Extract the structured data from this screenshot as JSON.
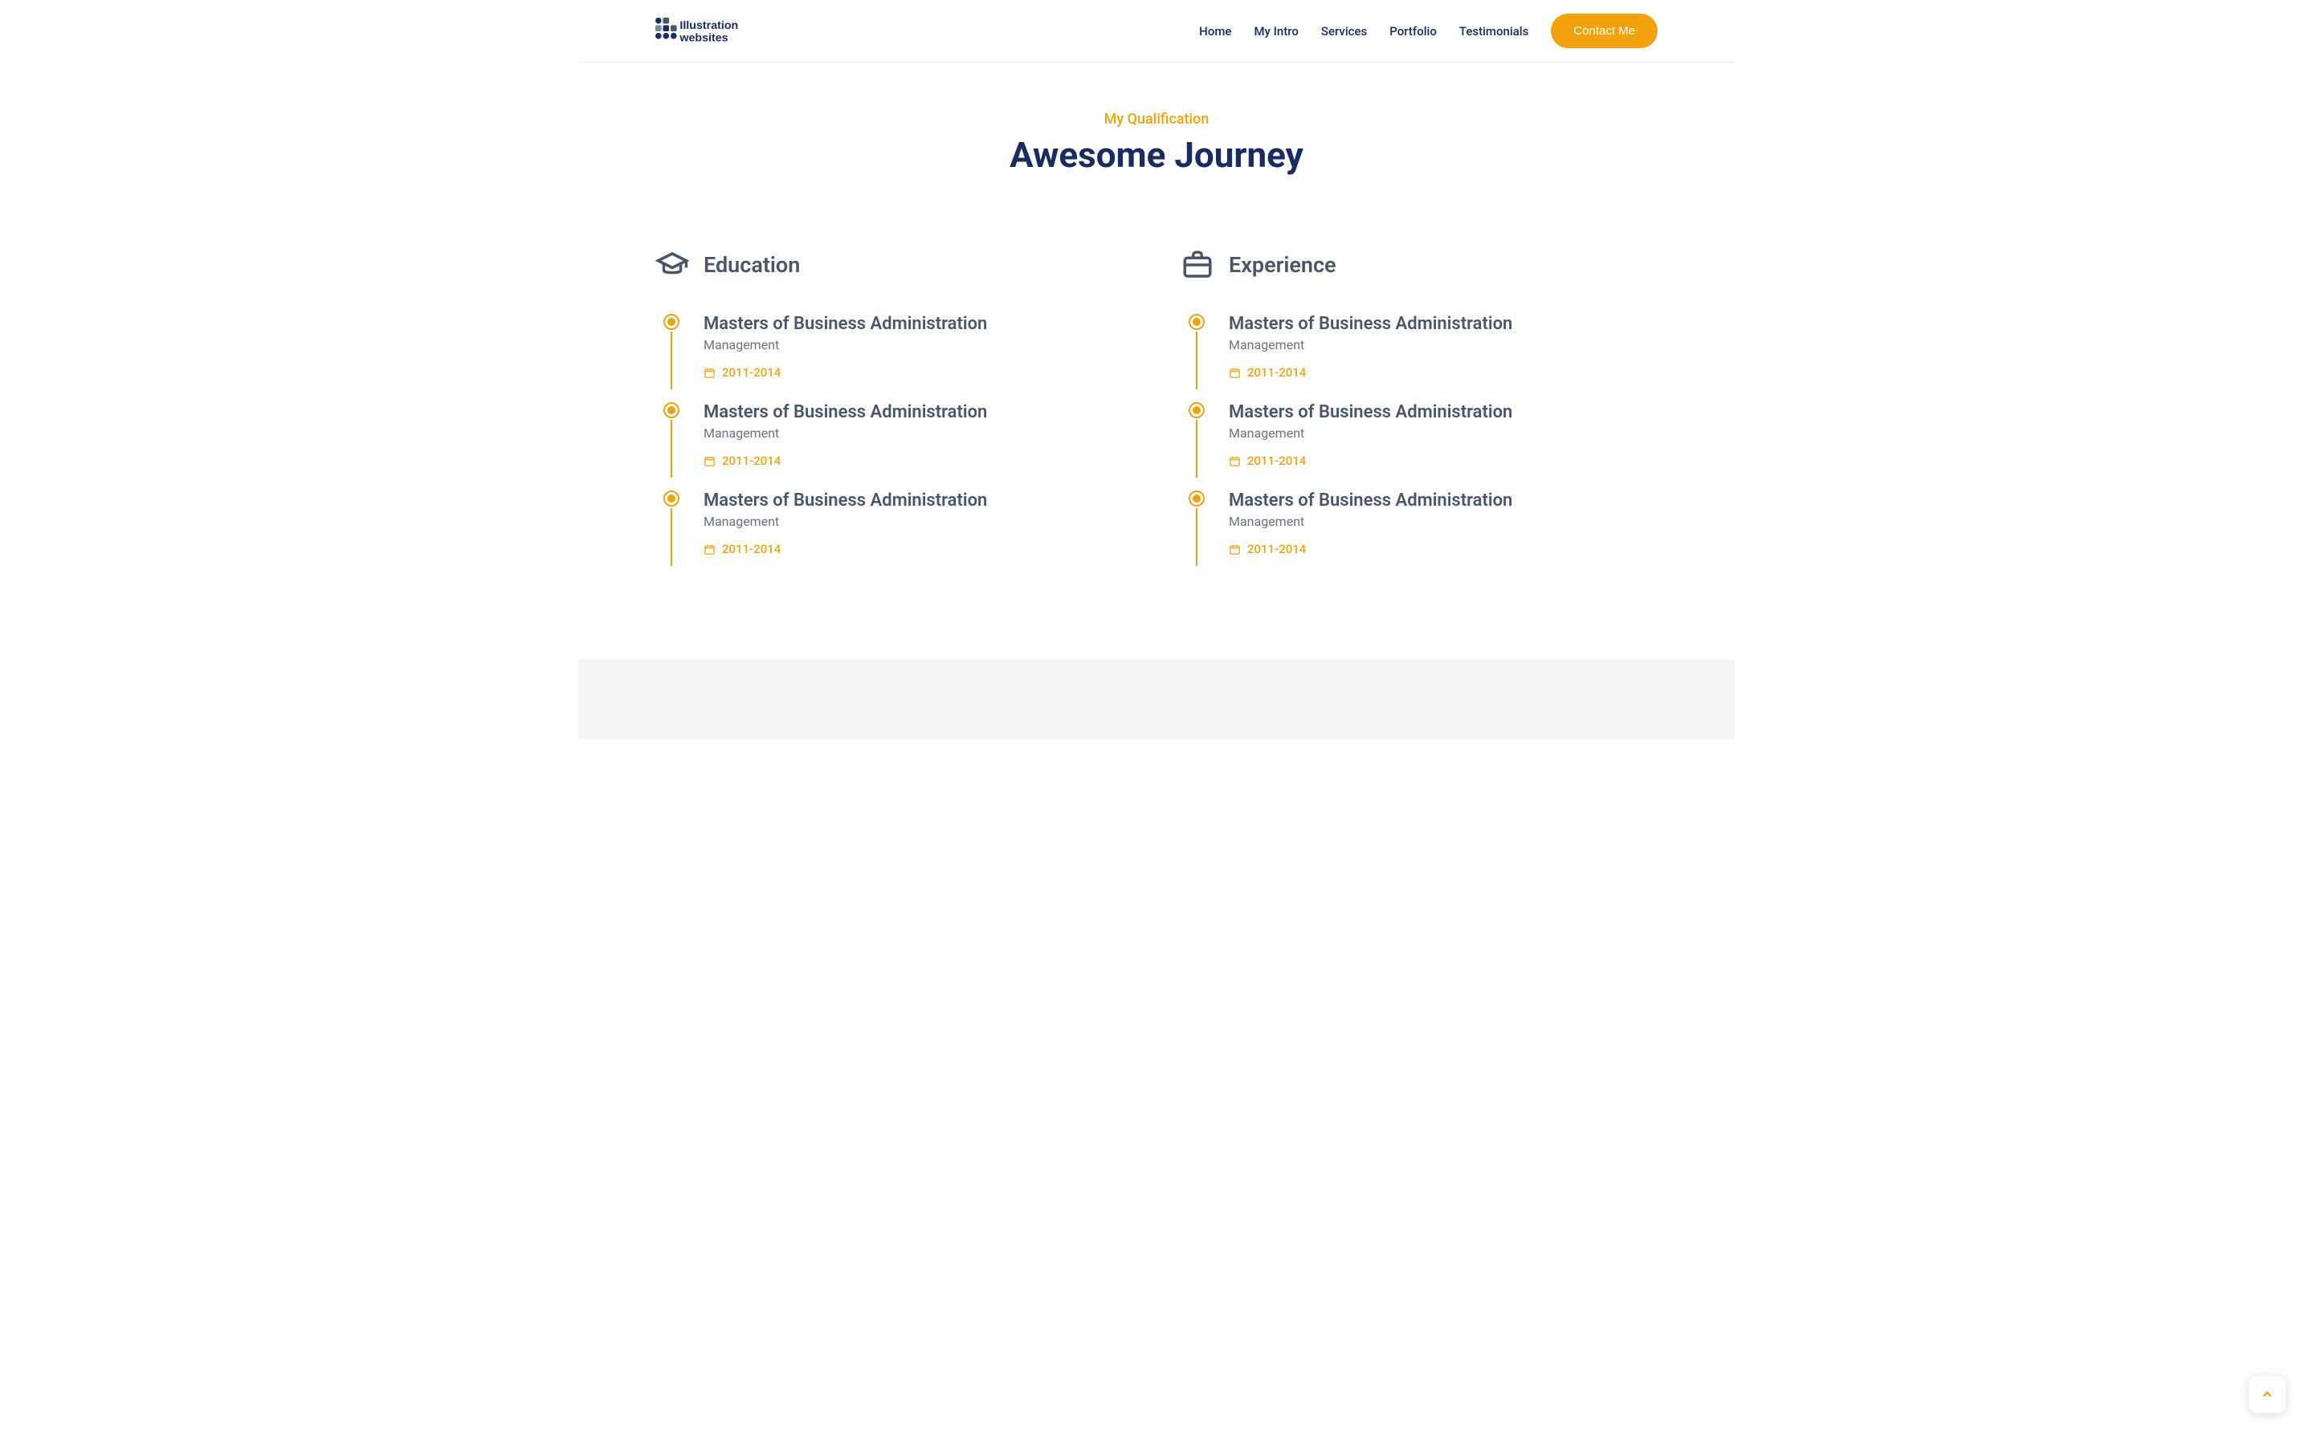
{
  "nav": {
    "items": [
      "Home",
      "My Intro",
      "Services",
      "Portfolio",
      "Testimonials"
    ],
    "cta": "Contact Me"
  },
  "logo": {
    "line1": "Illustration",
    "line2": "websites"
  },
  "section": {
    "eyebrow": "My Qualification",
    "title": "Awesome Journey"
  },
  "columns": [
    {
      "heading": "Education",
      "items": [
        {
          "title": "Masters of Business Administration",
          "sub": "Management",
          "date": "2011-2014"
        },
        {
          "title": "Masters of Business Administration",
          "sub": "Management",
          "date": "2011-2014"
        },
        {
          "title": "Masters of Business Administration",
          "sub": "Management",
          "date": "2011-2014"
        }
      ]
    },
    {
      "heading": "Experience",
      "items": [
        {
          "title": "Masters of Business Administration",
          "sub": "Management",
          "date": "2011-2014"
        },
        {
          "title": "Masters of Business Administration",
          "sub": "Management",
          "date": "2011-2014"
        },
        {
          "title": "Masters of Business Administration",
          "sub": "Management",
          "date": "2011-2014"
        }
      ]
    }
  ]
}
